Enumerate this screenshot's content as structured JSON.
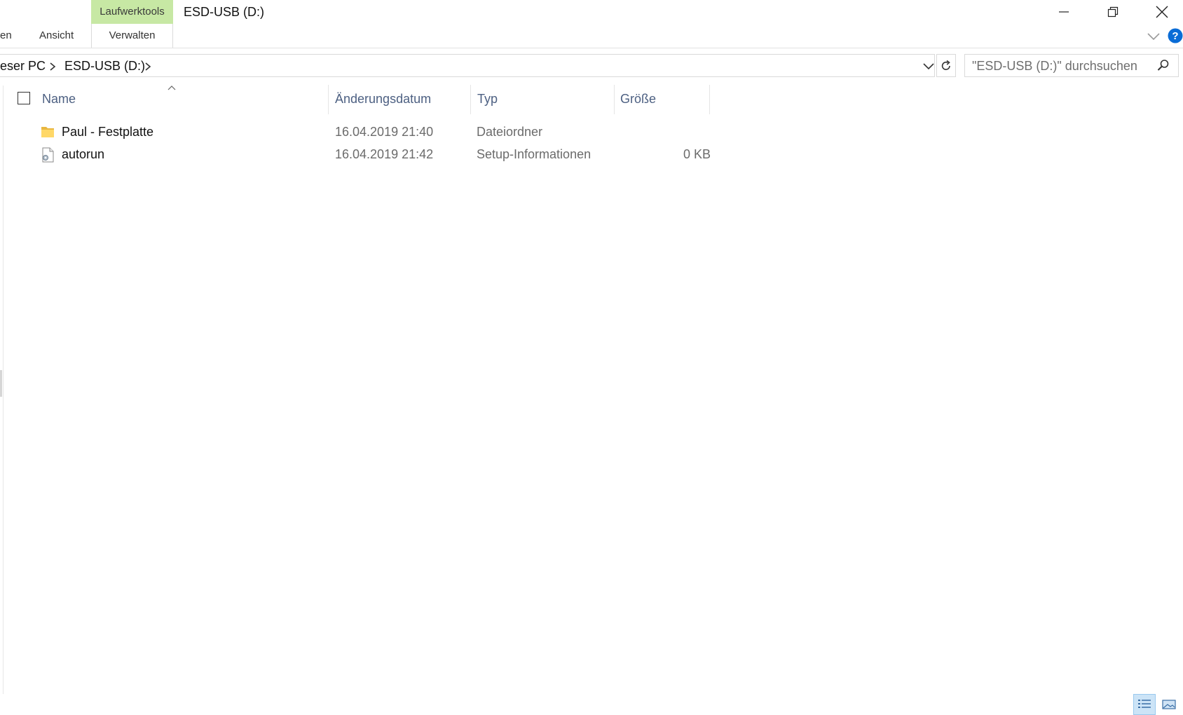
{
  "window": {
    "title": "ESD-USB (D:)",
    "context_tab_group": "Laufwerktools"
  },
  "ribbon": {
    "tabs": [
      {
        "label": "en"
      },
      {
        "label": "Ansicht"
      },
      {
        "label": "Verwalten"
      }
    ]
  },
  "address": {
    "breadcrumbs": [
      "eser PC",
      "ESD-USB (D:)"
    ]
  },
  "search": {
    "placeholder": "\"ESD-USB (D:)\" durchsuchen"
  },
  "columns": {
    "name": "Name",
    "date": "Änderungsdatum",
    "type": "Typ",
    "size": "Größe"
  },
  "files": [
    {
      "name": "Paul - Festplatte",
      "date": "16.04.2019 21:40",
      "type": "Dateiordner",
      "size": "",
      "icon": "folder-icon"
    },
    {
      "name": "autorun",
      "date": "16.04.2019 21:42",
      "type": "Setup-Informationen",
      "size": "0 KB",
      "icon": "setup-file-icon"
    }
  ],
  "colors": {
    "context_tab": "#c7e8a4",
    "header_text": "#4d6082",
    "help_blue": "#0a6cd6",
    "view_selected": "#cce4f7"
  }
}
